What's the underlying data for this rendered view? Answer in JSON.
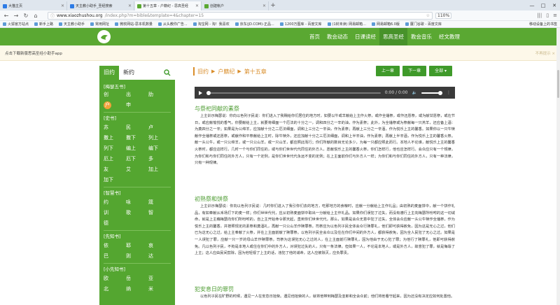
{
  "browser": {
    "tabs": [
      {
        "label": "大猫主页",
        "color": "#2d7be5",
        "active": false
      },
      {
        "label": "天主教小助手_圣经搜索",
        "color": "#2d7be5",
        "active": false
      },
      {
        "label": "第十五章 - 户籍纪 - 思高圣经",
        "color": "#5aa832",
        "active": true
      },
      {
        "label": "创建帐户",
        "color": "#5aa832",
        "active": false
      }
    ],
    "new_tab": "+",
    "window_buttons": [
      "—",
      "□",
      "✕"
    ],
    "url_host": "www.xiaozhushou.org",
    "url_rest": "/index.php?m=bible&template=4&chapter=15",
    "zoom": "110%",
    "bookmarks": [
      "火狐官方站点",
      "新手上路",
      "天主教小助手",
      "常用网址",
      "微软网站-思本机数量",
      "从头教你广告...",
      "淘宝网 - 淘！我喜欢",
      "京东(JD.COM)-正品...",
      "1200万图库 - 百度文库",
      "(1封未读) 网易邮箱...",
      "网易邮箱6.0版",
      "厦门谷歌 - 百度文库"
    ],
    "bookmarks_right": "移动设备上的书签"
  },
  "site": {
    "nav": [
      "首页",
      "教会动态",
      "日课读经",
      "思高圣经",
      "教会音乐",
      "经文教理"
    ],
    "nav_current": 3,
    "promo_text": "点击下载新版思高圣经小助手app",
    "promo_close": "不再提示 ×"
  },
  "sidebar": {
    "tabs": [
      "旧约",
      "新约"
    ],
    "sections": [
      {
        "title": "[梅瑟五书]",
        "items": [
          "创",
          "出",
          "肋",
          "户",
          "申"
        ],
        "active": "户"
      },
      {
        "title": "[史书]",
        "items": [
          "苏",
          "民",
          "卢",
          "撒上",
          "撒下",
          "列上",
          "列下",
          "编上",
          "编下",
          "厄上",
          "厄下",
          "多",
          "友",
          "艾",
          "加上",
          "加下"
        ]
      },
      {
        "title": "[智慧书]",
        "items": [
          "约",
          "咏",
          "箴",
          "训",
          "歌",
          "智",
          "德"
        ]
      },
      {
        "title": "[先知书]",
        "items": [
          "依",
          "耶",
          "哀",
          "巴",
          "则",
          "达"
        ]
      },
      {
        "title": "[小先知书]",
        "items": [
          "欧",
          "岳",
          "亚",
          "北",
          "纳",
          "米"
        ]
      }
    ]
  },
  "content": {
    "crumbs": [
      "旧约",
      "户籍纪",
      "第十五章"
    ],
    "buttons": {
      "prev": "上一章",
      "next": "下一章",
      "all": "全部 ▾"
    },
    "player_time": "0:00 / 0:00",
    "sections": [
      {
        "title": "与祭祀同献的素祭",
        "text": "上主训示梅瑟说：你向以色列子民说：你们进入了我赐给你们居住的地方时，如要以牛或羊献给上主作火祭，或作全燔祭，或作还愿祭，或为献甘愿祭，或在节日，或应献愉悦的香气，你要献给上主，就要将细面一个厄法的十分之一，调和四分之一辛的油，作为素祭；此外，为全燔祭或为祭献每一只羔羊，还应备上酒：为奠四分之一辛；如果是为公绵羊，应加献十分之二厄法细面，调和上三分之一辛油，作为素祭；再献上三分之一辛酒，作为悦乐上主的馨香。如果你以一只牛犊献作全燔祭或还愿祭，或献作和平祭献给上主时，除牛犊外，还应加献十分之三厄法细面，调和上半辛油，作为素祭；再献上半辛酒，作为悦乐上主的馨香火祭。献一头公牛，或一只公绵羊，或一只公山羊，或一只山羊，都应照此而行；你们所献的数目无论多少，为每一只都应照此而行。本地人不论谁，献悦乐上主的馨香火祭时，都应这样行。几时一个与你们同住的，或与你们世世代代同住的外方人，愿献悦乐上主的馨香火祭，你们怎样行，他也应怎样行。会众应只有一个规律，为你们和与你们同住的外方人，只有一个定例，是你们世世代代永远不变的定例；在上主面前你们与外方人一样；为你们和与你们同住的外方人，只有一种法律，只有一种规律。"
      },
      {
        "title": "初熟祭和饼祭",
        "text": "上主训示梅瑟说：你向以色列子民说：几时你们进入了我引你们去的地方，吃那地方的食粮时，应献一分献给上主作礼品；由初熟的麦面饼中，献一个饼作礼品，有如奉献从禾场打下的麦一样；你们世世代代，应从初熟麦面饼中取出一分献给上主作礼品。如果你们误犯了过失，而没有遵行上主向梅瑟所吩咐的这一切诫命，就是上主藉梅瑟向你们所吩咐的，自上主开始命令那天起，直到你们世世代代，那么，如果是会众无意中犯了过失，全体会众应献一头公牛犊作全燔祭，作为悦乐上主的馨香，并按照规定的素祭和奠酒礼，再献一只公山羊作赎罪祭。司祭应为以色列子民全体会众行赎罪礼，他们即可获得赦免，因为这是无心之过，他们已为这无心之过，给上主奉献了火祭，并在上主面前献了赎罪祭。以色列子民全会众以及住在你们中间的外方人，都获得赦免，因为全人民犯了无心之过。如果是一人误犯了罪，应献一只一岁的母山羊作赎罪祭。司祭为这误犯无心之过的人，在上主面前行赎罪礼，因为他由于无心犯了罪；为他行了赎罪礼，他即可获得赦免。凡以色列子民，不拘是本地人或住在你们中的外方人，对误犯过失的人，只有一条法律。但如果一人，不论是本地人，或是外方人，故意犯了罪，就是侮辱了上主；这人应由民间剪除，因为他轻视了上主的话，违犯了他的诫命，这人应被除灭，应负罪责。"
      },
      {
        "title": "犯安息日的罪罚",
        "text": "以色列子民在旷野的时候，遇见一人在安息日拾柴。遇见他拾柴的人，就将他带到梅瑟及亚郎和全会众前；他们将他看守起来，因为还没有决定应如何处置他。"
      }
    ]
  }
}
